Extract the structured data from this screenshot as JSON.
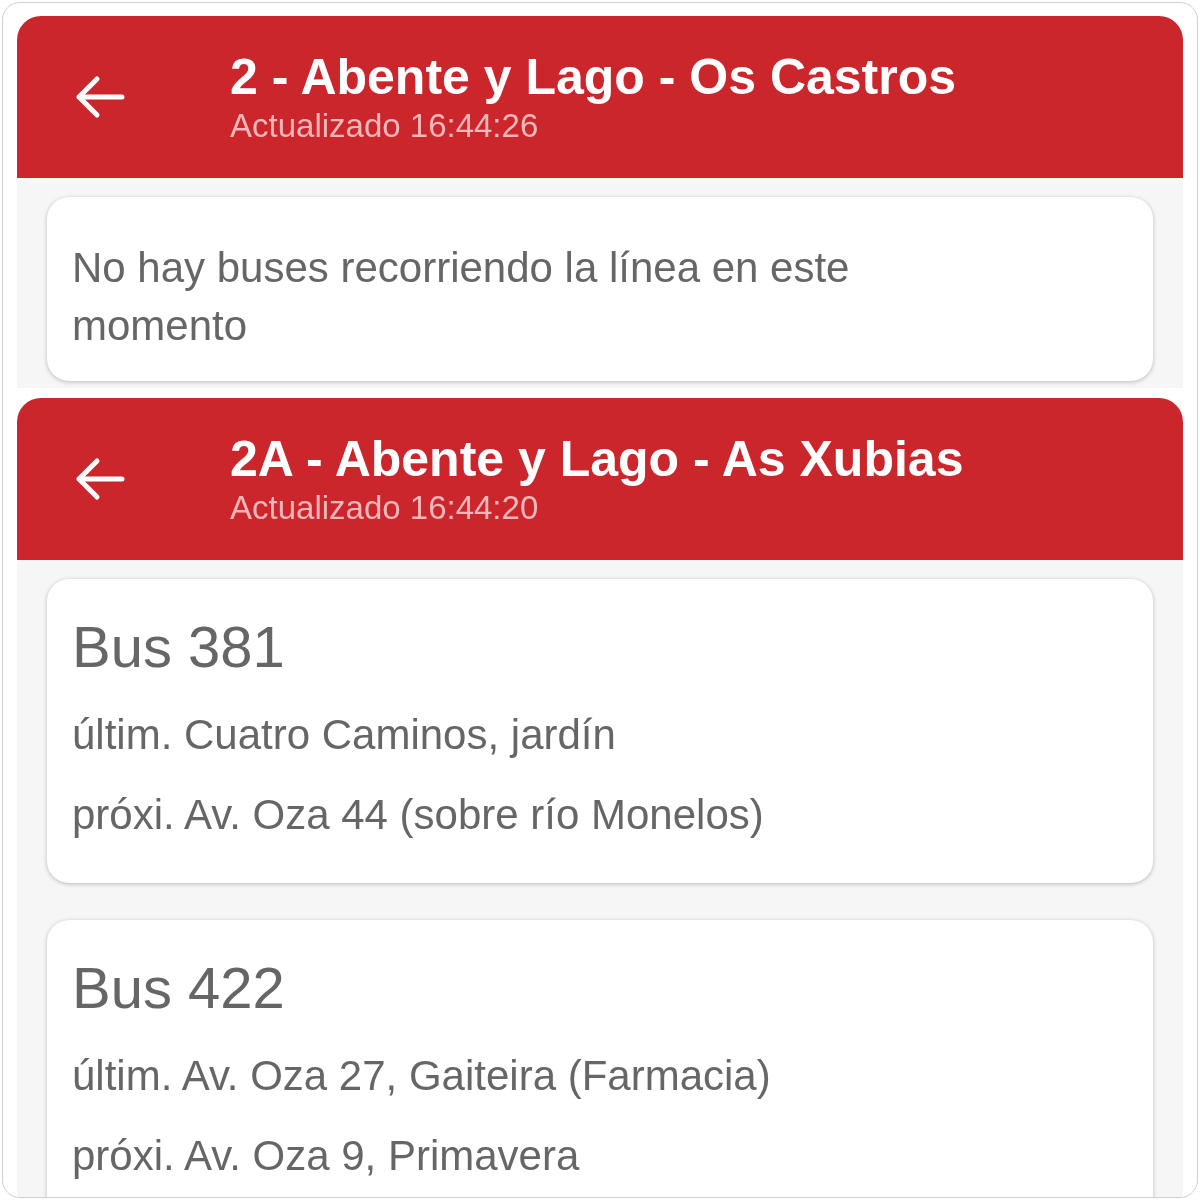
{
  "panels": [
    {
      "title": "2 - Abente y Lago - Os Castros",
      "updated": "Actualizado 16:44:26",
      "cards": [
        {
          "kind": "message",
          "text": "No hay buses recorriendo la línea en este momento"
        }
      ]
    },
    {
      "title": "2A - Abente y Lago - As Xubias",
      "updated": "Actualizado 16:44:20",
      "cards": [
        {
          "kind": "bus",
          "name": "Bus 381",
          "last": "últim. Cuatro Caminos, jardín",
          "next": "próxi. Av. Oza 44 (sobre río Monelos)"
        },
        {
          "kind": "bus",
          "name": "Bus 422",
          "last": "últim. Av. Oza 27, Gaiteira (Farmacia)",
          "next": "próxi. Av. Oza 9, Primavera"
        }
      ]
    }
  ]
}
